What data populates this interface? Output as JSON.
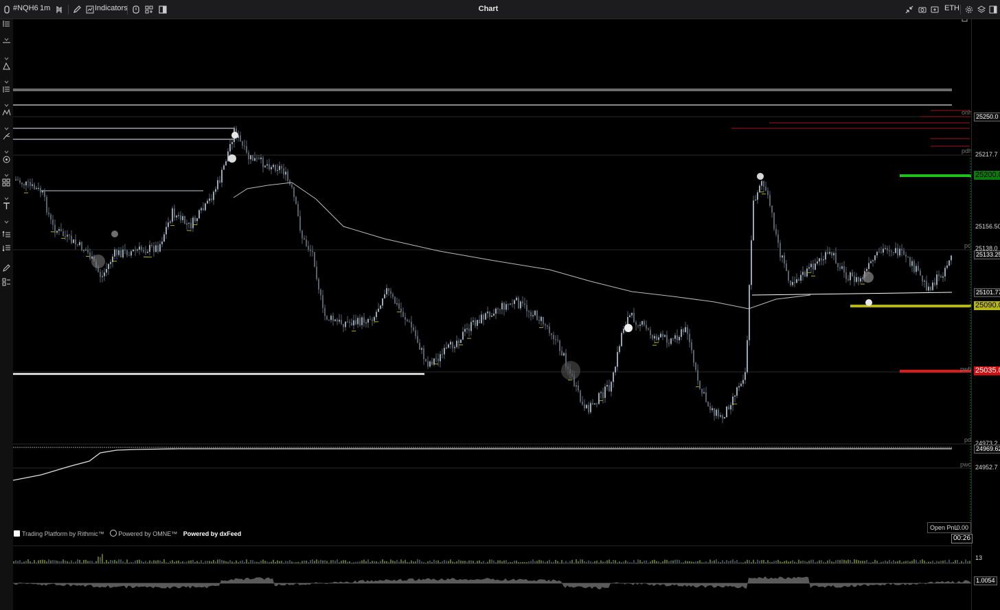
{
  "topbar": {
    "symbol": "#NQH6",
    "interval": "1m",
    "indicators_label": "Indicators",
    "title": "Chart",
    "session": "ETH"
  },
  "levels": {
    "onh": "onh",
    "pdh": "pdh",
    "pc": "pc",
    "pwh": "pwh",
    "pdl": "pdl",
    "pwc": "pwc"
  },
  "price_axis": {
    "p1": "25250.0",
    "p2": "25217.7",
    "p3": "25200.0",
    "p4": "25156.50",
    "p5": "25138.0",
    "p6": "25133.25",
    "p7": "25101.77",
    "p8": "25090.0",
    "p9": "25035.0",
    "p10": "24973.2",
    "p11": "24969.62",
    "p12": "24952.7"
  },
  "footer": {
    "rithmic": "Trading Platform by Rithmic™",
    "omne": "Powered by OMNE™",
    "dxfeed": "Powered by dxFeed",
    "open_pnl_label": "Open PnL",
    "open_pnl_value": "0.00",
    "timer": "00:26"
  },
  "sub_panels": {
    "volume_value": "13",
    "indicator_value": "1.0054"
  },
  "colors": {
    "target": "#1fbf1f",
    "stop": "#e01818",
    "entry": "#b5b51a",
    "candle": "#7d8c99"
  }
}
